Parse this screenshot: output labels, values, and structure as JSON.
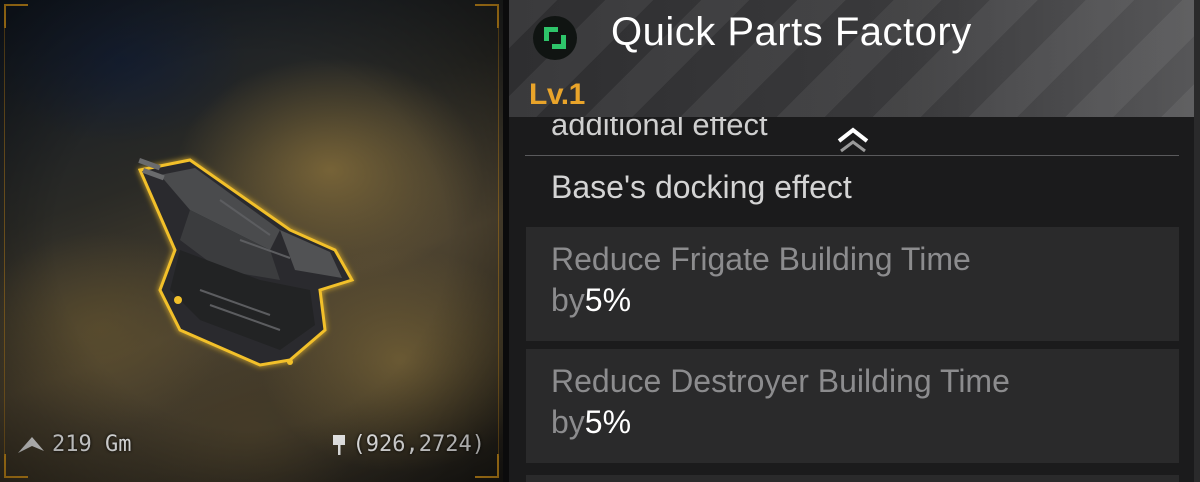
{
  "viewport": {
    "distance": "219 Gm",
    "coordinates": "(926,2724)",
    "frame_color": "#e8a21e"
  },
  "panel": {
    "title": "Quick Parts Factory",
    "level": "Lv.1",
    "level_color": "#e9a42a",
    "icon_color": "#2ec46a",
    "cut_heading": "additional effect",
    "section_heading": "Base's docking effect",
    "effects": [
      {
        "line1": "Reduce Frigate Building Time",
        "prefix": "by",
        "value": "5%"
      },
      {
        "line1": "Reduce Destroyer Building Time",
        "prefix": "by",
        "value": "5%"
      }
    ]
  }
}
